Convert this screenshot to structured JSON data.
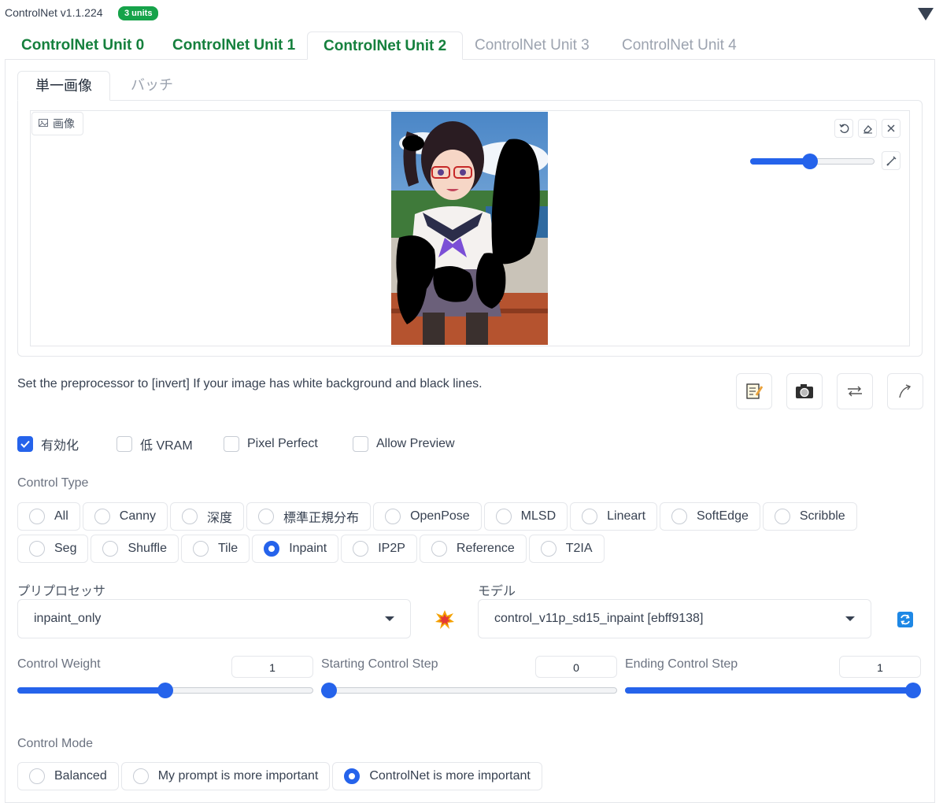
{
  "header": {
    "title": "ControlNet v1.1.224",
    "badge": "3 units"
  },
  "unit_tabs": [
    {
      "label": "ControlNet Unit 0",
      "state": "enabled"
    },
    {
      "label": "ControlNet Unit 1",
      "state": "enabled"
    },
    {
      "label": "ControlNet Unit 2",
      "state": "selected"
    },
    {
      "label": "ControlNet Unit 3",
      "state": "disabled"
    },
    {
      "label": "ControlNet Unit 4",
      "state": "disabled"
    }
  ],
  "image_tabs": [
    {
      "label": "単一画像",
      "selected": true
    },
    {
      "label": "バッチ",
      "selected": false
    }
  ],
  "image_panel": {
    "label": "画像",
    "brush_size_fraction": 0.48
  },
  "hint": "Set the preprocessor to [invert] If your image has white background and black lines.",
  "icons": {
    "edit": "edit-icon",
    "camera": "camera-icon",
    "swap": "swap-icon",
    "send": "send-icon",
    "explode": "explode-icon",
    "refresh": "refresh-icon"
  },
  "checkboxes": [
    {
      "label": "有効化",
      "checked": true
    },
    {
      "label": "低 VRAM",
      "checked": false
    },
    {
      "label": "Pixel Perfect",
      "checked": false
    },
    {
      "label": "Allow Preview",
      "checked": false
    }
  ],
  "control_type": {
    "label": "Control Type",
    "options": [
      "All",
      "Canny",
      "深度",
      "標準正規分布",
      "OpenPose",
      "MLSD",
      "Lineart",
      "SoftEdge",
      "Scribble",
      "Seg",
      "Shuffle",
      "Tile",
      "Inpaint",
      "IP2P",
      "Reference",
      "T2IA"
    ],
    "selected": "Inpaint"
  },
  "preprocessor": {
    "label": "プリプロセッサ",
    "value": "inpaint_only"
  },
  "model": {
    "label": "モデル",
    "value": "control_v11p_sd15_inpaint [ebff9138]"
  },
  "sliders": [
    {
      "label": "Control Weight",
      "value": "1",
      "fraction": 0.5
    },
    {
      "label": "Starting Control Step",
      "value": "0",
      "fraction": 0.0
    },
    {
      "label": "Ending Control Step",
      "value": "1",
      "fraction": 1.0
    }
  ],
  "control_mode": {
    "label": "Control Mode",
    "options": [
      "Balanced",
      "My prompt is more important",
      "ControlNet is more important"
    ],
    "selected": "ControlNet is more important"
  },
  "colors": {
    "accent": "#2563eb",
    "enabled_tab": "#15803d",
    "badge": "#16a34a"
  }
}
